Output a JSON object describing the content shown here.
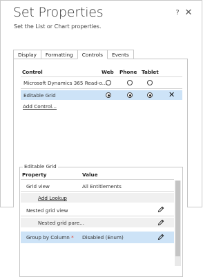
{
  "header": {
    "title": "Set Properties",
    "subtitle": "Set the List or Chart properties."
  },
  "window_icons": {
    "help": "question-mark-icon",
    "close": "close-icon"
  },
  "tabs": [
    {
      "label": "Display",
      "active": false
    },
    {
      "label": "Formatting",
      "active": false
    },
    {
      "label": "Controls",
      "active": true
    },
    {
      "label": "Events",
      "active": false
    }
  ],
  "controls_table": {
    "headers": {
      "control": "Control",
      "web": "Web",
      "phone": "Phone",
      "tablet": "Tablet"
    },
    "rows": [
      {
        "name": "Microsoft Dynamics 365 Read-o...",
        "web": false,
        "phone": false,
        "tablet": false,
        "selected": false
      },
      {
        "name": "Editable Grid",
        "web": true,
        "phone": true,
        "tablet": true,
        "selected": true
      }
    ],
    "add_control_label": "Add Control..."
  },
  "editable_grid": {
    "legend": "Editable Grid",
    "headers": {
      "property": "Property",
      "value": "Value"
    },
    "rows": [
      {
        "property": "Grid view",
        "value": "All Entitlements"
      },
      {
        "property": "Add Lookup",
        "value": ""
      },
      {
        "property": "Nested grid view",
        "value": ""
      },
      {
        "property": "Nested grid pare...",
        "value": ""
      },
      {
        "property": "Group by Column",
        "value": "Disabled (Enum)",
        "required_marker": "*"
      }
    ]
  },
  "colors": {
    "selected_row": "#cde3f7",
    "required": "#e0301e",
    "border": "#c6c6c6"
  }
}
